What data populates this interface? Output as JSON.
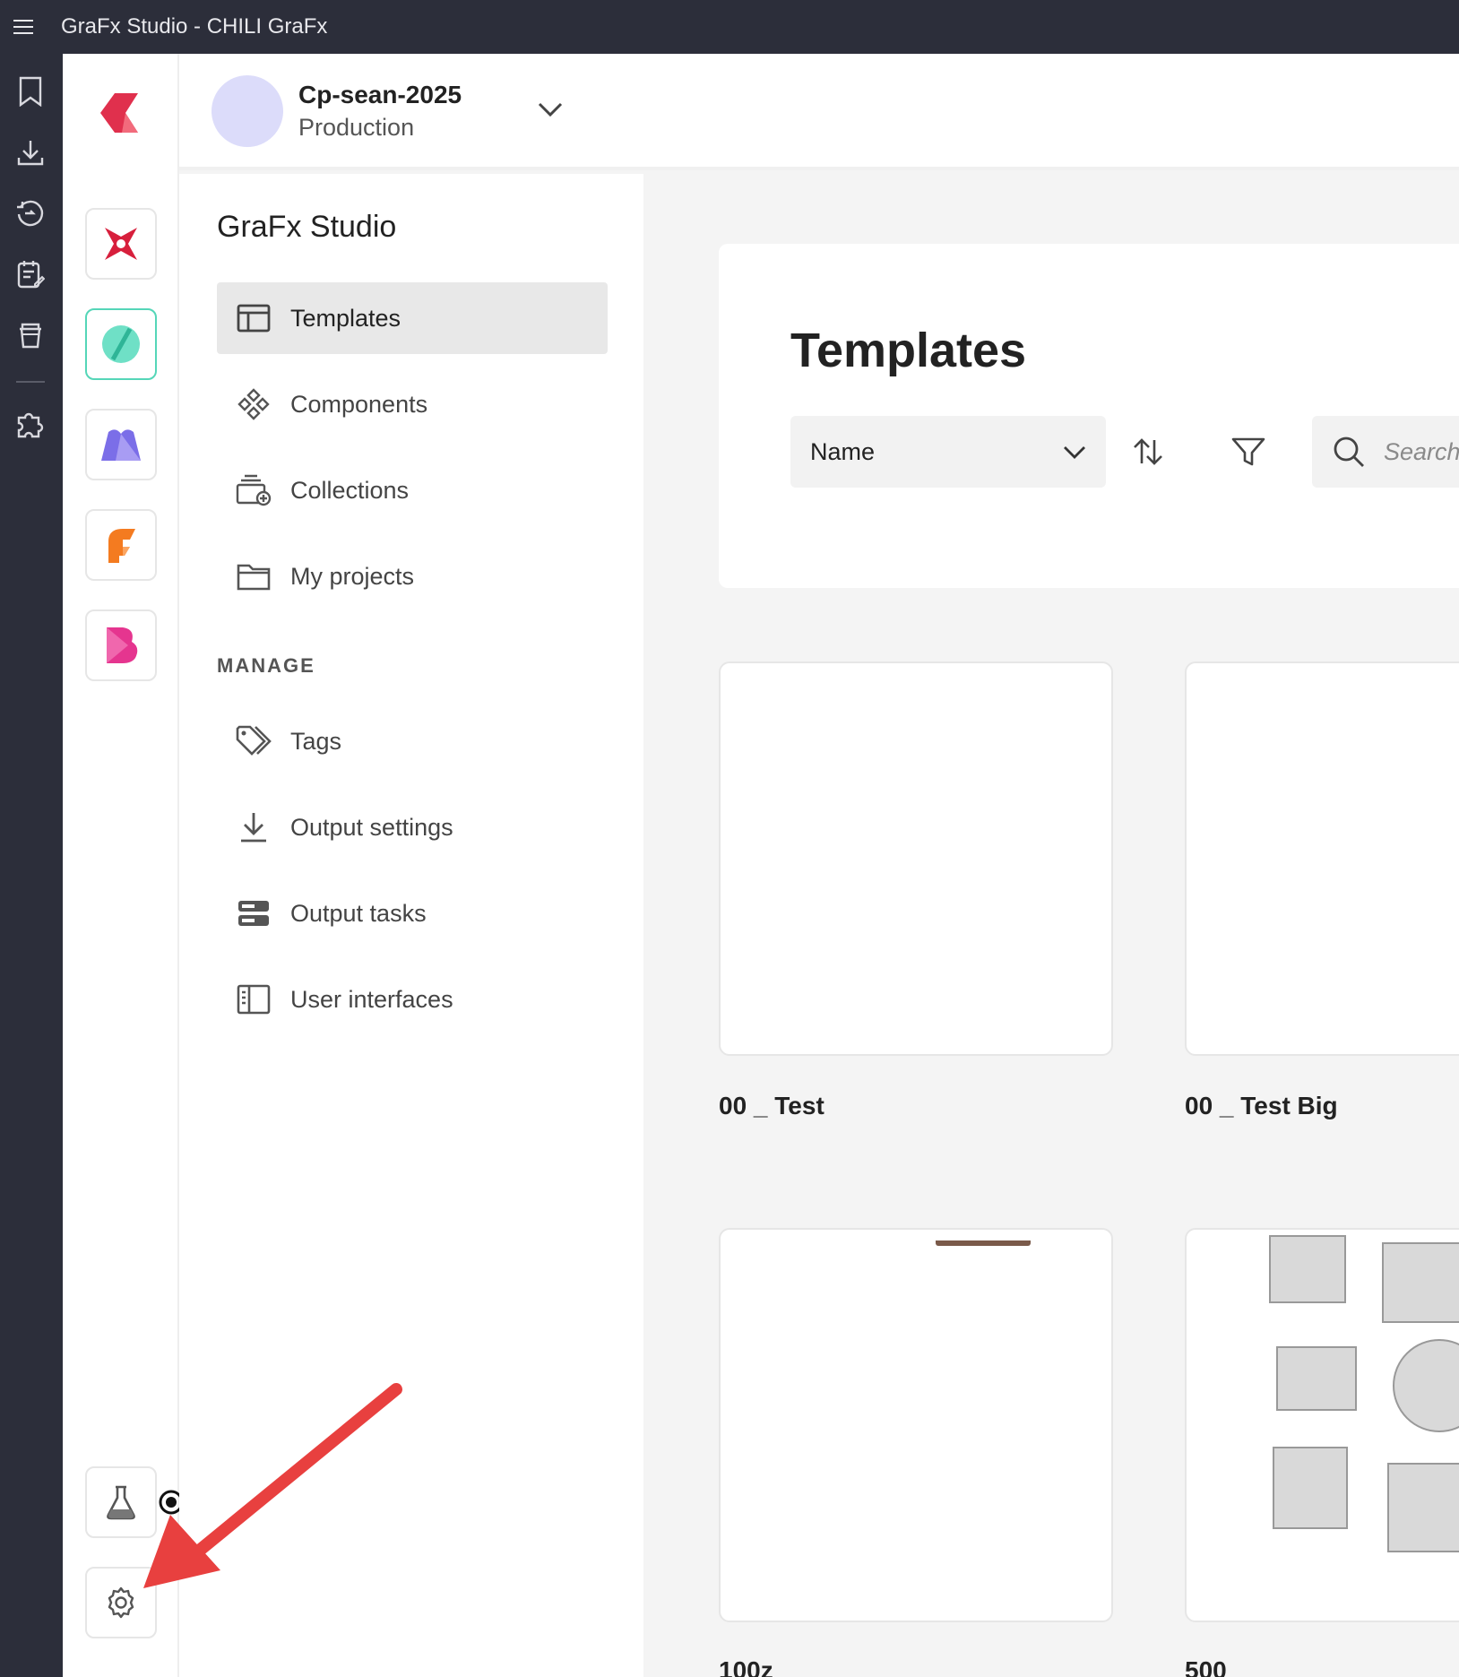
{
  "window": {
    "title": "GraFx Studio - CHILI GraFx"
  },
  "environment": {
    "name": "Cp-sean-2025",
    "type": "Production"
  },
  "sidebar": {
    "title": "GraFx Studio",
    "items": [
      {
        "label": "Templates",
        "icon": "layout-icon",
        "active": true
      },
      {
        "label": "Components",
        "icon": "components-icon"
      },
      {
        "label": "Collections",
        "icon": "collections-icon"
      },
      {
        "label": "My projects",
        "icon": "folder-icon"
      }
    ],
    "manage_label": "MANAGE",
    "manage_items": [
      {
        "label": "Tags",
        "icon": "tag-icon"
      },
      {
        "label": "Output settings",
        "icon": "download-icon"
      },
      {
        "label": "Output tasks",
        "icon": "tasks-icon"
      },
      {
        "label": "User interfaces",
        "icon": "ui-icon"
      }
    ]
  },
  "main": {
    "title": "Templates",
    "sort": {
      "selected": "Name"
    },
    "search": {
      "placeholder": "Search"
    },
    "cards": [
      {
        "title": "00 _ Test"
      },
      {
        "title": "00 _ Test Big"
      },
      {
        "title": "100z"
      },
      {
        "title": "500"
      }
    ]
  },
  "colors": {
    "titlebar": "#2c2e3a",
    "accent_teal": "#55d6b8",
    "annotation_red": "#e8403f",
    "avatar": "#dcdcfa"
  }
}
